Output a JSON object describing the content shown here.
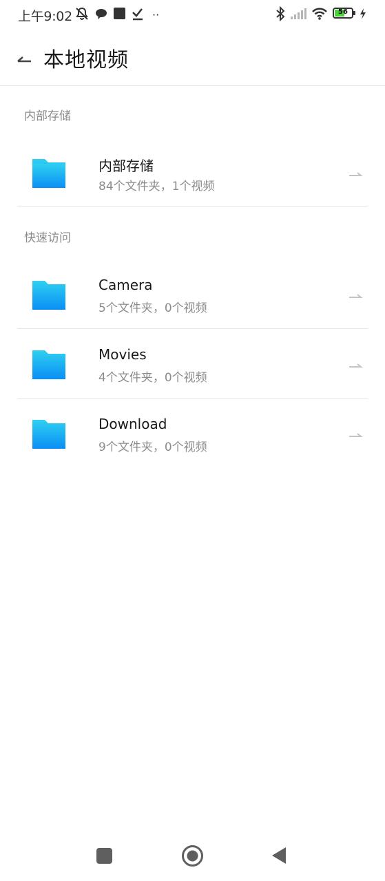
{
  "status_bar": {
    "time": "上午9:02",
    "battery_level": "56",
    "icons": [
      "mute-icon",
      "chat-icon",
      "square-icon",
      "check-icon",
      "more-dots-icon",
      "bluetooth-icon",
      "signal-icon",
      "wifi-icon",
      "battery-icon",
      "charging-icon"
    ]
  },
  "header": {
    "title": "本地视频",
    "back_icon": "back-arrow-icon"
  },
  "sections": [
    {
      "label": "内部存储",
      "items": [
        {
          "name": "内部存储",
          "meta": "84个文件夹，1个视频"
        }
      ]
    },
    {
      "label": "快速访问",
      "items": [
        {
          "name": "Camera",
          "meta": "5个文件夹，0个视频"
        },
        {
          "name": "Movies",
          "meta": "4个文件夹，0个视频"
        },
        {
          "name": "Download",
          "meta": "9个文件夹，0个视频"
        }
      ]
    }
  ],
  "colors": {
    "folder_top": "#2fd0f0",
    "folder_bottom": "#0a8ff5",
    "secondary_text": "#8c8c8c",
    "divider": "#e6e6e6"
  },
  "nav_bar": {
    "icons": [
      "recents-icon",
      "home-icon",
      "back-triangle-icon"
    ]
  }
}
